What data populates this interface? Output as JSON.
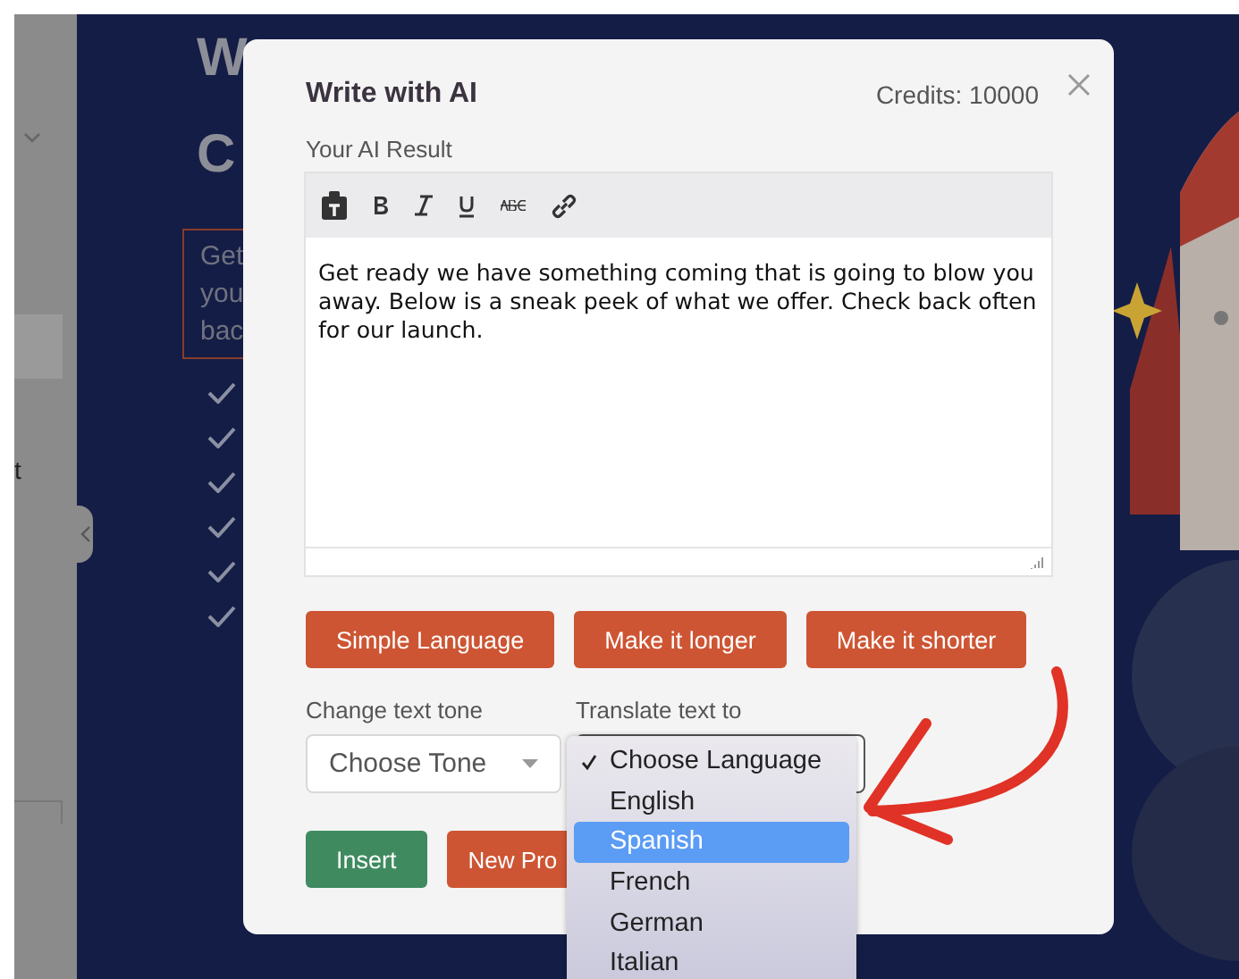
{
  "background": {
    "heading_lines": [
      "W",
      "C"
    ],
    "intro_lines": [
      "Get",
      "you",
      "bac"
    ],
    "sidebar_text": "t"
  },
  "modal": {
    "title": "Write with AI",
    "credits": "Credits: 10000",
    "result_label": "Your AI Result",
    "editor_text": "Get ready we have something coming that is going to blow you away. Below is a sneak peek of what we offer. Check back often for our launch.",
    "action_buttons": [
      "Simple Language",
      "Make it longer",
      "Make it shorter"
    ],
    "tone": {
      "label": "Change text tone",
      "value": "Choose Tone"
    },
    "language": {
      "label": "Translate text to",
      "options": [
        {
          "label": "Choose Language",
          "checked": true,
          "selected": false
        },
        {
          "label": "English",
          "checked": false,
          "selected": false
        },
        {
          "label": "Spanish",
          "checked": false,
          "selected": true
        },
        {
          "label": "French",
          "checked": false,
          "selected": false
        },
        {
          "label": "German",
          "checked": false,
          "selected": false
        },
        {
          "label": "Italian",
          "checked": false,
          "selected": false
        }
      ]
    },
    "footer_buttons": [
      {
        "label": "Insert",
        "kind": "primary"
      },
      {
        "label": "New Pro",
        "kind": "secondary"
      }
    ]
  }
}
